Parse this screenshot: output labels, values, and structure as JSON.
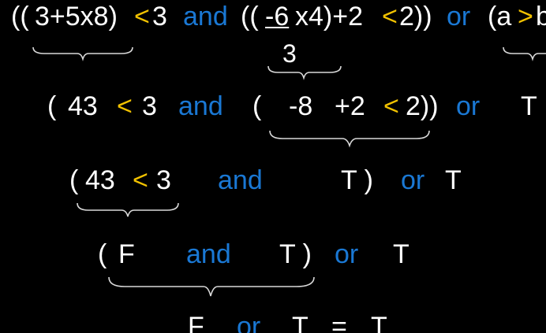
{
  "slide": {
    "line1": {
      "open_parens": "((",
      "arith": "3+5x8)",
      "lt": "<",
      "three": "3",
      "and": "and",
      "open2": "((",
      "neg6": "-6",
      "x4": "x4)+2",
      "lt2": "<",
      "two_close": "2))",
      "or": "or",
      "open3": "(a",
      "gt": ">",
      "b": "b"
    },
    "denominator": "3",
    "line2": {
      "open": "(",
      "v43": "43",
      "lt": "<",
      "three": "3",
      "and": "and",
      "open2": "(",
      "neg8": "-8",
      "plus2": "+2",
      "lt2": "<",
      "two_close": "2))",
      "or": "or",
      "t": "T"
    },
    "line3": {
      "open": "(",
      "v43": "43",
      "lt": "<",
      "three": "3",
      "and": "and",
      "t_close": "T )",
      "or": "or",
      "t": "T"
    },
    "line4": {
      "open": "(",
      "f": "F",
      "and": "and",
      "t_close": "T )",
      "or": "or",
      "t": "T"
    },
    "line5": {
      "f": "F",
      "or": "or",
      "t": "T",
      "eq": "=",
      "result": "T"
    }
  }
}
